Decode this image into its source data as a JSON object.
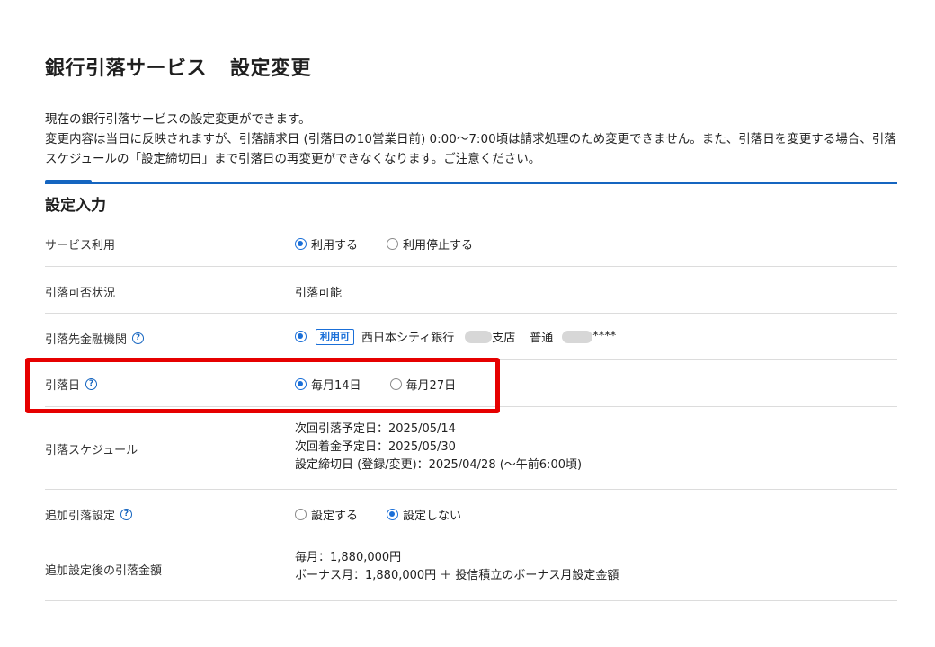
{
  "page": {
    "title_main": "銀行引落サービス",
    "title_sub": "設定変更",
    "description_lines": [
      "現在の銀行引落サービスの設定変更ができます。",
      "変更内容は当日に反映されますが、引落請求日 (引落日の10営業日前) 0:00〜7:00頃は請求処理のため変更できません。また、引落日を変更する場合、引落スケジュールの「設定締切日」まで引落日の再変更ができなくなります。ご注意ください。"
    ]
  },
  "section": {
    "title": "設定入力"
  },
  "rows": {
    "service": {
      "label": "サービス利用",
      "options": [
        {
          "label": "利用する",
          "selected": true
        },
        {
          "label": "利用停止する",
          "selected": false
        }
      ]
    },
    "status": {
      "label": "引落可否状況",
      "value": "引落可能"
    },
    "bank": {
      "label": "引落先金融機関",
      "badge": "利用可",
      "bank_name": "西日本シティ銀行",
      "branch_suffix": "支店",
      "account_type": "普通",
      "account_suffix": "****"
    },
    "date": {
      "label": "引落日",
      "options": [
        {
          "label": "毎月14日",
          "selected": true
        },
        {
          "label": "毎月27日",
          "selected": false
        }
      ]
    },
    "schedule": {
      "label": "引落スケジュール",
      "lines": [
        "次回引落予定日：2025/05/14",
        "次回着金予定日：2025/05/30",
        "設定締切日 (登録/変更)：2025/04/28 (〜午前6:00頃)"
      ]
    },
    "additional": {
      "label": "追加引落設定",
      "options": [
        {
          "label": "設定する",
          "selected": false
        },
        {
          "label": "設定しない",
          "selected": true
        }
      ]
    },
    "amount": {
      "label": "追加設定後の引落金額",
      "lines": [
        "毎月：1,880,000円",
        "ボーナス月：1,880,000円 ＋ 投信積立のボーナス月設定金額"
      ]
    }
  },
  "help_icon_glyph": "?",
  "colors": {
    "accent": "#1565c0",
    "radio": "#1a6fd8",
    "highlight": "#e60000",
    "divider": "#dcdcdc"
  }
}
